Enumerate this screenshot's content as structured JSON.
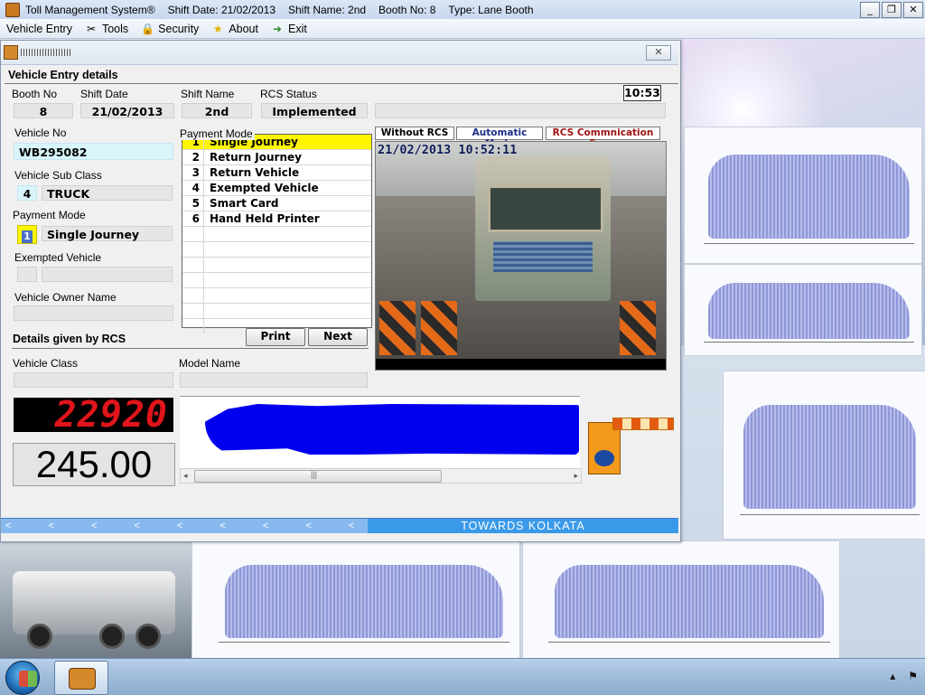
{
  "app": {
    "title": "Toll Management System®",
    "shift_date": "Shift Date: 21/02/2013",
    "shift_name": "Shift Name: 2nd",
    "booth_no": "Booth No: 8",
    "type": "Type: Lane Booth"
  },
  "window_buttons": {
    "minimize": "_",
    "restore": "❐",
    "close": "✕"
  },
  "menu": [
    {
      "label": "Vehicle Entry",
      "icon": ""
    },
    {
      "label": "Tools",
      "icon": "tools-icon"
    },
    {
      "label": "Security",
      "icon": "lock-icon"
    },
    {
      "label": "About",
      "icon": "star-icon"
    },
    {
      "label": "Exit",
      "icon": "exit-arrow-icon"
    }
  ],
  "child_window": {
    "close": "✕"
  },
  "section": {
    "title": "Vehicle Entry details",
    "rcs_details": "Details given by RCS"
  },
  "header_fields": {
    "booth_no_label": "Booth No",
    "booth_no": "8",
    "shift_date_label": "Shift Date",
    "shift_date": "21/02/2013",
    "shift_name_label": "Shift Name",
    "shift_name": "2nd",
    "rcs_status_label": "RCS Status",
    "rcs_status": "Implemented",
    "clock": "10:53"
  },
  "vehicle": {
    "vehicle_no_label": "Vehicle No",
    "vehicle_no": "WB295082",
    "sub_class_label": "Vehicle Sub Class",
    "sub_class_code": "4",
    "sub_class": "TRUCK",
    "payment_mode_label": "Payment Mode",
    "payment_code": "1",
    "payment_mode": "Single Journey",
    "exempted_label": "Exempted Vehicle",
    "owner_label": "Vehicle Owner Name",
    "vehicle_class_label": "Vehicle Class",
    "model_name_label": "Model Name"
  },
  "payment_list": {
    "legend": "Payment Mode",
    "items": [
      {
        "num": "1",
        "label": "Single Journey",
        "selected": true
      },
      {
        "num": "2",
        "label": "Return Journey"
      },
      {
        "num": "3",
        "label": "Return Vehicle"
      },
      {
        "num": "4",
        "label": "Exempted Vehicle"
      },
      {
        "num": "5",
        "label": "Smart Card"
      },
      {
        "num": "6",
        "label": "Hand Held Printer"
      }
    ]
  },
  "buttons": {
    "print": "Print",
    "next": "Next"
  },
  "rcs_tags": {
    "without": "Without RCS",
    "auto": "Automatic Mode",
    "error": "RCS Commnication Error"
  },
  "camera": {
    "timestamp": "21/02/2013 10:52:11"
  },
  "counter": "22920",
  "amount": "245.00",
  "scroll": {
    "left": "◂",
    "grip": "|||",
    "right": "▸"
  },
  "direction": {
    "arrows": "< < < < < < < < < < < < < < <",
    "text": "TOWARDS   KOLKATA"
  },
  "colors": {
    "selected_row": "#fff600",
    "counter_text": "#e0141b",
    "profile": "#0000ef",
    "direction_bar": "#3a9ae8"
  }
}
